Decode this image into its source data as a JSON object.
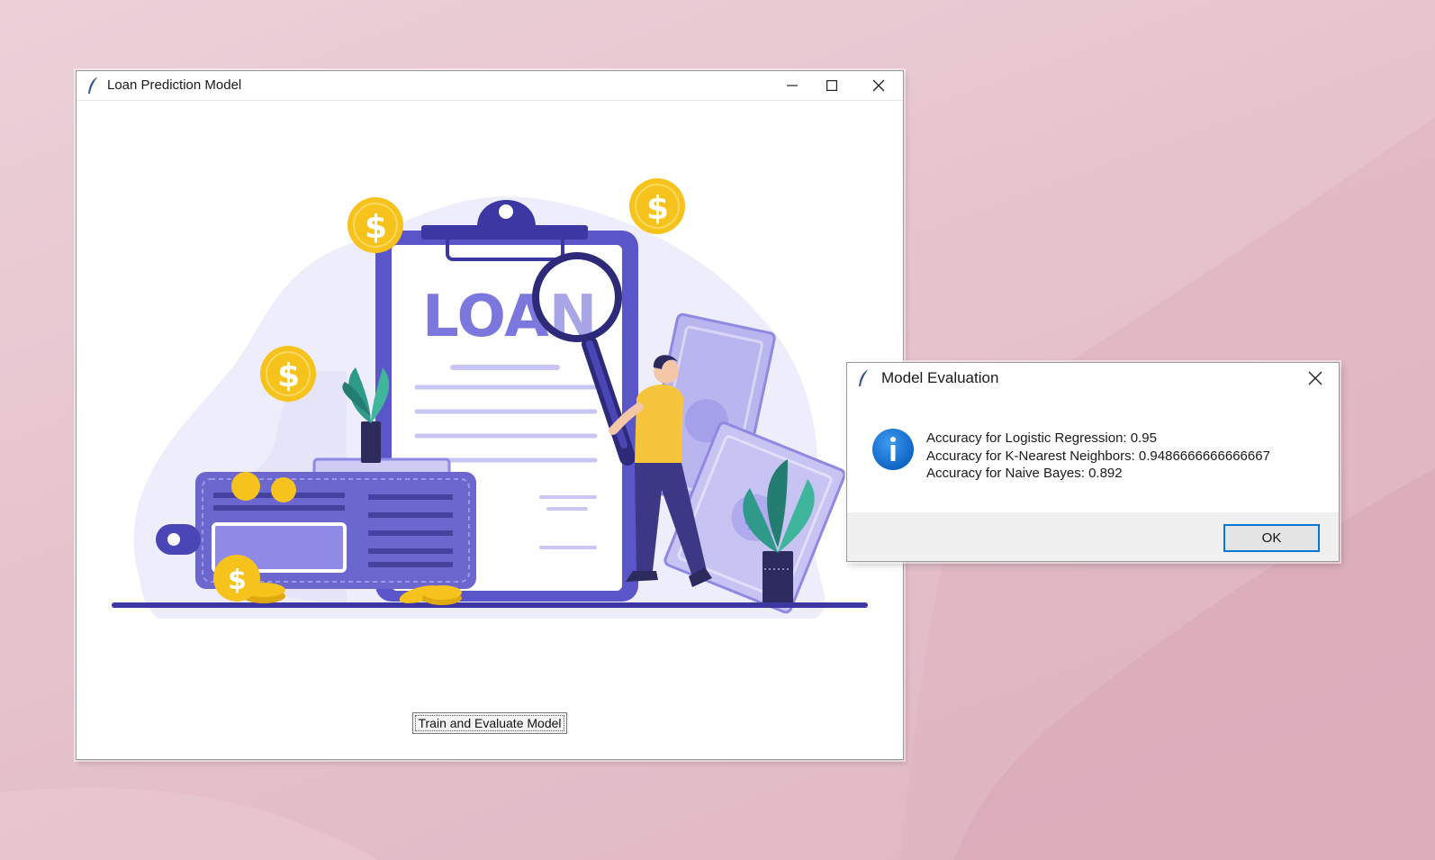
{
  "main_window": {
    "title": "Loan Prediction Model",
    "illustration": {
      "clipboard_text": "LOAN",
      "coin_symbol": "$"
    },
    "train_button_label": "Train and Evaluate Model"
  },
  "dialog": {
    "title": "Model Evaluation",
    "icon": "info-icon",
    "lines": [
      "Accuracy for Logistic Regression: 0.95",
      "Accuracy for K-Nearest Neighbors: 0.9486666666666667",
      "Accuracy for Naive Bayes: 0.892"
    ],
    "ok_label": "OK"
  },
  "colors": {
    "accent_purple": "#5a55c8",
    "light_purple": "#e9e7fb",
    "coin_gold": "#f6c21c",
    "info_blue": "#0a6fd1",
    "ok_border": "#0078d7"
  }
}
